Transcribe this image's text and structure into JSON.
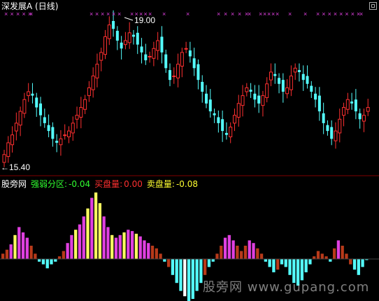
{
  "top_panel": {
    "title": "深发展A (日线)",
    "max_label": "19.00",
    "min_label": "15.40",
    "signal_marker": "×"
  },
  "sub_panel": {
    "indicator_name": "股旁网",
    "strength_label": "强弱分区:",
    "strength_value": "-0.04",
    "buy_label": "买盘量:",
    "buy_value": "0.00",
    "sell_label": "卖盘量:",
    "sell_value": "-0.08"
  },
  "watermark": "股旁网 www.gupang.com",
  "colors": {
    "background": "#000000",
    "up": "#ff3030",
    "down": "#54ffff",
    "magenta": "#e040e0",
    "yellow": "#ffff60",
    "white": "#ffffff",
    "brown": "#b83a1a",
    "divider": "#800000",
    "green_text": "#30ff30",
    "red_text": "#ff3030",
    "yellow_text": "#ffff30"
  },
  "chart_data": [
    {
      "type": "candlestick",
      "title": "深发展A (日线)",
      "series": [
        {
          "name": "close",
          "values": [
            15.6,
            15.9,
            16.1,
            16.4,
            16.7,
            17.0,
            17.2,
            17.1,
            16.8,
            16.6,
            16.4,
            16.2,
            16.0,
            15.9,
            16.0,
            16.1,
            16.2,
            16.4,
            16.6,
            16.8,
            17.0,
            17.3,
            17.6,
            17.9,
            18.2,
            18.6,
            18.9,
            18.8,
            18.5,
            18.3,
            18.5,
            18.7,
            18.6,
            18.4,
            18.2,
            18.0,
            18.1,
            18.3,
            18.5,
            18.2,
            17.8,
            17.5,
            17.6,
            17.9,
            18.2,
            18.3,
            18.1,
            17.8,
            17.5,
            17.2,
            16.9,
            16.7,
            16.6,
            16.4,
            16.2,
            16.1,
            16.3,
            16.6,
            16.9,
            17.1,
            17.3,
            17.2,
            17.0,
            16.9,
            17.1,
            17.4,
            17.7,
            17.6,
            17.4,
            17.2,
            17.3,
            17.6,
            17.8,
            17.7,
            17.5,
            17.4,
            17.2,
            17.0,
            16.7,
            16.4,
            16.2,
            16.0,
            16.2,
            16.5,
            16.8,
            17.0,
            16.9,
            16.7,
            16.5,
            16.6,
            16.8
          ]
        }
      ],
      "ylim": [
        15.4,
        19.0
      ],
      "annotations": [
        "19.00",
        "15.40"
      ]
    },
    {
      "type": "bar",
      "title": "股旁网",
      "series": [
        {
          "name": "强弱分区",
          "values": [
            0.2,
            0.35,
            0.55,
            0.9,
            1.2,
            1.0,
            0.8,
            0.5,
            0.2,
            -0.1,
            -0.2,
            -0.35,
            -0.2,
            -0.1,
            0.1,
            0.3,
            0.6,
            0.9,
            1.1,
            1.3,
            1.6,
            1.9,
            2.3,
            2.5,
            2.1,
            1.6,
            1.2,
            0.9,
            0.8,
            0.9,
            1.0,
            1.1,
            1.05,
            0.95,
            0.85,
            0.7,
            0.6,
            0.5,
            0.4,
            0.2,
            -0.1,
            -0.3,
            -0.6,
            -0.9,
            -1.2,
            -1.4,
            -1.6,
            -1.5,
            -1.2,
            -0.9,
            -0.6,
            -0.3,
            -0.1,
            0.2,
            0.5,
            0.8,
            0.9,
            0.7,
            0.5,
            0.3,
            0.5,
            0.7,
            0.6,
            0.4,
            0.2,
            -0.1,
            -0.3,
            -0.5,
            -0.4,
            -0.2,
            -0.3,
            -0.6,
            -0.9,
            -1.0,
            -0.8,
            -0.5,
            -0.2,
            0.1,
            0.3,
            0.2,
            0.1,
            -0.1,
            0.4,
            0.7,
            0.5,
            0.2,
            -0.2,
            -0.4,
            -0.6,
            -0.3,
            -0.04
          ]
        },
        {
          "name": "买盘量",
          "values": [
            0.0
          ]
        },
        {
          "name": "卖盘量",
          "values": [
            -0.08
          ]
        }
      ],
      "values_latest": {
        "强弱分区": -0.04,
        "买盘量": 0.0,
        "卖盘量": -0.08
      }
    }
  ]
}
